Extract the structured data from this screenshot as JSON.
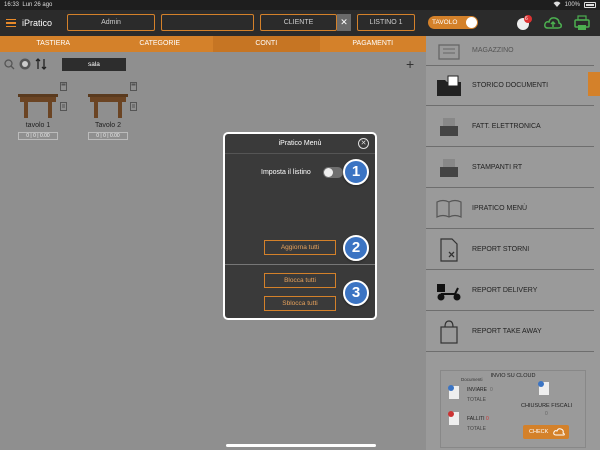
{
  "status_bar": {
    "time": "16:33",
    "date": "Lun 26 ago",
    "battery": "100%"
  },
  "header": {
    "logo": "iPratico",
    "fields": [
      "Admin",
      "",
      "CLIENTE",
      "LISTINO 1"
    ],
    "clear_symbol": "✕",
    "tavolo_label": "TAVOLO",
    "notification_count": "6"
  },
  "tabs": [
    {
      "label": "TASTIERA"
    },
    {
      "label": "CATEGORIE"
    },
    {
      "label": "CONTI"
    },
    {
      "label": "PAGAMENTI"
    }
  ],
  "toolbar": {
    "sala_label": "sala",
    "add_symbol": "+"
  },
  "tables": [
    {
      "label": "tavolo 1",
      "badge": "0  |  0  |  0.00"
    },
    {
      "label": "Tavolo 2",
      "badge": "0  |  0  |  0.00"
    }
  ],
  "right_menu": [
    {
      "label": "MAGAZZINO",
      "icon": "warehouse-icon"
    },
    {
      "label": "STORICO DOCUMENTI",
      "icon": "folder-icon"
    },
    {
      "label": "FATT. ELETTRONICA",
      "icon": "register-icon"
    },
    {
      "label": "STAMPANTI RT",
      "icon": "printer-icon"
    },
    {
      "label": "IPRATICO MENÙ",
      "icon": "book-icon"
    },
    {
      "label": "REPORT STORNI",
      "icon": "document-icon"
    },
    {
      "label": "REPORT DELIVERY",
      "icon": "scooter-icon"
    },
    {
      "label": "REPORT TAKE AWAY",
      "icon": "bag-icon"
    }
  ],
  "cloud": {
    "title": "INVIO SU CLOUD",
    "documenti": "Documenti",
    "inviare": "INVIARE",
    "inviare_count": "0",
    "totale1": "TOTALE",
    "falliti": "FALLITI",
    "falliti_count": "0",
    "totale2": "TOTALE",
    "chiusure": "CHIUSURE FISCALI",
    "chiusure_count": "0",
    "check": "CHECK"
  },
  "dialog": {
    "title": "iPratico Menù",
    "listino_label": "Imposta il listino",
    "aggiorna": "Aggiorna tutti",
    "blocca": "Blocca tutti",
    "sblocca": "Sblocca tutti"
  },
  "markers": [
    "1",
    "2",
    "3"
  ],
  "colors": {
    "accent": "#d4812a",
    "marker": "#3b74c3",
    "dark": "#2b2b2b"
  }
}
